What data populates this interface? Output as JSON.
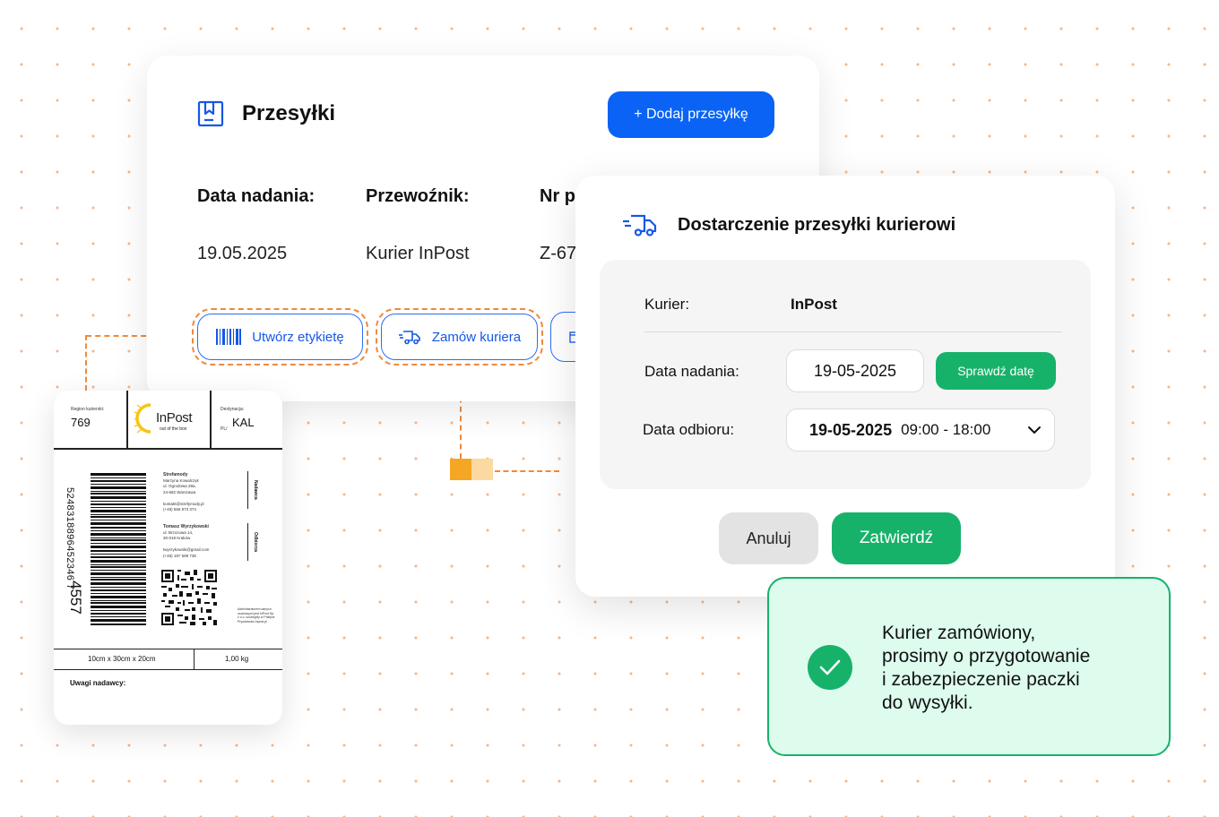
{
  "shipments": {
    "title": "Przesyłki",
    "add_button": "+ Dodaj przesyłkę",
    "columns": {
      "date_label": "Data nadania:",
      "carrier_label": "Przewoźnik:",
      "number_label": "Nr p"
    },
    "row": {
      "date": "19.05.2025",
      "carrier": "Kurier InPost",
      "number": "Z-67"
    },
    "actions": {
      "create_label": "Utwórz etykietę",
      "order_courier": "Zamów kuriera"
    }
  },
  "delivery": {
    "title": "Dostarczenie przesyłki kurierowi",
    "courier_label": "Kurier:",
    "courier_value": "InPost",
    "send_date_label": "Data nadania:",
    "send_date_value": "19-05-2025",
    "check_date_button": "Sprawdź datę",
    "pickup_label": "Data odbioru:",
    "pickup_date": "19-05-2025",
    "pickup_time": "09:00 - 18:00",
    "cancel_button": "Anuluj",
    "confirm_button": "Zatwierdź"
  },
  "toast": {
    "lines": [
      "Kurier zamówiony,",
      "prosimy o przygotowanie",
      "i zabezpieczenie paczki",
      "do wysyłki."
    ]
  },
  "label": {
    "region_title": "Region kurierski:",
    "region_value": "769",
    "logo_brand": "InPost",
    "logo_tagline": "out of the box",
    "destination_title": "Destynacja:",
    "destination_country": "PL/",
    "destination_value": "KAL",
    "barcode_number": "5248318896452346 7",
    "barcode_big": "4557",
    "sender_tag": "Nadawca",
    "recipient_tag": "Odbiorca",
    "sender": {
      "name": "Strefamody",
      "person": "Marzyna Kowalczyk",
      "street": "ul. Ogrodowa 28a,",
      "city": "24-682 Warszawa",
      "email": "kontakt@strefymody.pl",
      "phone": "(+48) 556 873 374"
    },
    "recipient": {
      "name": "Tomasz Wyrzykowski",
      "street": "ul. Brzozowa 14,",
      "city": "30-018 Kraków",
      "email": "twyrzykowski@gmail.com",
      "phone": "(+48) 197 598 735"
    },
    "qr_note": "Administratorem danych osobowych jest InPost Sp. z o.o. szczegóły w Polityce Prywatności inpost.pl",
    "dimensions": "10cm x 30cm x 20cm",
    "weight": "1,00 kg",
    "notes_label": "Uwagi nadawcy:"
  },
  "colors": {
    "primary_blue": "#0a63f5",
    "success_green": "#17b26a",
    "toast_bg": "#ddfcee",
    "connector_orange": "#ef8a3b",
    "square_orange": "#f5a623",
    "square_light": "#fbd9a0"
  },
  "icons": {
    "shipments": "bookmark-box-icon",
    "barcode": "barcode-icon",
    "truck": "delivery-truck-icon",
    "chevron": "chevron-down-icon",
    "check": "checkmark-icon"
  }
}
